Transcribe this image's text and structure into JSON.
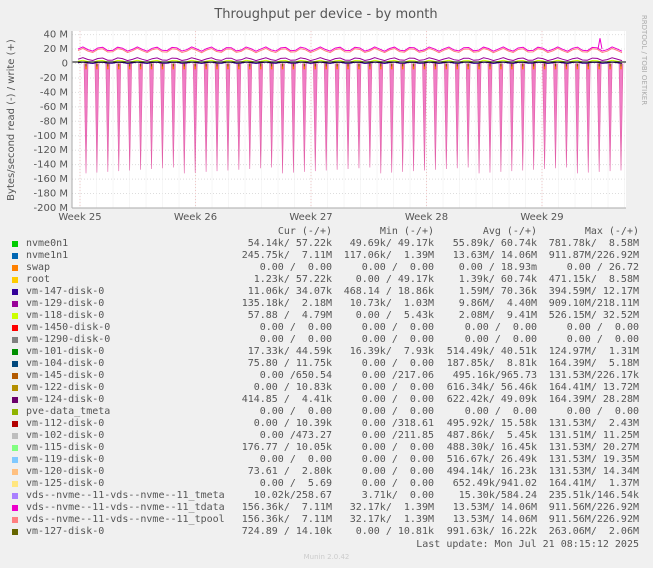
{
  "chart_data": {
    "type": "line",
    "title": "Throughput per device - by month",
    "ylabel": "Bytes/second read (-) / write (+)",
    "side_label": "RRDTOOL / TOBI OETIKER",
    "ylim": [
      -200000000,
      45000000
    ],
    "y_ticks": [
      "40 M",
      "20 M",
      "0",
      "-20 M",
      "-40 M",
      "-60 M",
      "-80 M",
      "-100 M",
      "-120 M",
      "-140 M",
      "-160 M",
      "-180 M",
      "-200 M"
    ],
    "y_tick_values": [
      40,
      20,
      0,
      -20,
      -40,
      -60,
      -80,
      -100,
      -120,
      -140,
      -160,
      -180,
      -200
    ],
    "x_ticks": [
      "Week 25",
      "Week 26",
      "Week 27",
      "Week 28",
      "Week 29"
    ],
    "grid": true,
    "columns": [
      "Cur (-/+)",
      "Min (-/+)",
      "Avg (-/+)",
      "Max (-/+)"
    ],
    "series": [
      {
        "name": "nvme0n1",
        "color": "#00cc00",
        "cur": "54.14k/ 57.22k",
        "min": "49.69k/ 49.17k",
        "avg": "55.89k/ 60.74k",
        "max": "781.78k/  8.58M"
      },
      {
        "name": "nvme1n1",
        "color": "#0066b3",
        "cur": "245.75k/  7.11M",
        "min": "117.06k/  1.39M",
        "avg": "13.63M/ 14.06M",
        "max": "911.87M/226.92M"
      },
      {
        "name": "swap",
        "color": "#ff8000",
        "cur": "0.00 /  0.00",
        "min": "0.00 /  0.00",
        "avg": "0.00 / 18.93m",
        "max": "0.00 / 26.72"
      },
      {
        "name": "root",
        "color": "#ffcc00",
        "cur": "1.23k/ 57.22k",
        "min": "0.00 / 49.17k",
        "avg": "1.39k/ 60.74k",
        "max": "471.15k/  8.58M"
      },
      {
        "name": "vm-147-disk-0",
        "color": "#330099",
        "cur": "11.06k/ 34.07k",
        "min": "468.14 / 18.86k",
        "avg": "1.59M/ 70.36k",
        "max": "394.59M/ 12.17M"
      },
      {
        "name": "vm-129-disk-0",
        "color": "#990099",
        "cur": "135.18k/  2.18M",
        "min": "10.73k/  1.03M",
        "avg": "9.86M/  4.40M",
        "max": "909.10M/218.11M"
      },
      {
        "name": "vm-118-disk-0",
        "color": "#ccff00",
        "cur": "57.88 /  4.79M",
        "min": "0.00 /  5.43k",
        "avg": "2.08M/  9.41M",
        "max": "526.15M/ 32.52M"
      },
      {
        "name": "vm-1450-disk-0",
        "color": "#ff0000",
        "cur": "0.00 /  0.00",
        "min": "0.00 /  0.00",
        "avg": "0.00 /  0.00",
        "max": "0.00 /  0.00"
      },
      {
        "name": "vm-1290-disk-0",
        "color": "#808080",
        "cur": "0.00 /  0.00",
        "min": "0.00 /  0.00",
        "avg": "0.00 /  0.00",
        "max": "0.00 /  0.00"
      },
      {
        "name": "vm-101-disk-0",
        "color": "#008f00",
        "cur": "17.33k/ 44.59k",
        "min": "16.39k/  7.93k",
        "avg": "514.49k/ 40.51k",
        "max": "124.97M/  1.31M"
      },
      {
        "name": "vm-104-disk-0",
        "color": "#00487d",
        "cur": "75.80 / 11.75k",
        "min": "0.00 /  0.00",
        "avg": "187.85k/  8.81k",
        "max": "164.39M/  5.18M"
      },
      {
        "name": "vm-145-disk-0",
        "color": "#b35a00",
        "cur": "0.00 /650.54",
        "min": "0.00 /217.06",
        "avg": "495.16k/965.73",
        "max": "131.53M/226.17k"
      },
      {
        "name": "vm-122-disk-0",
        "color": "#b38f00",
        "cur": "0.00 / 10.83k",
        "min": "0.00 /  0.00",
        "avg": "616.34k/ 56.46k",
        "max": "164.41M/ 13.72M"
      },
      {
        "name": "vm-124-disk-0",
        "color": "#6b006b",
        "cur": "414.85 /  4.41k",
        "min": "0.00 /  0.00",
        "avg": "622.42k/ 49.09k",
        "max": "164.39M/ 28.28M"
      },
      {
        "name": "pve-data_tmeta",
        "color": "#8fb300",
        "cur": "0.00 /  0.00",
        "min": "0.00 /  0.00",
        "avg": "0.00 /  0.00",
        "max": "0.00 /  0.00"
      },
      {
        "name": "vm-112-disk-0",
        "color": "#b30000",
        "cur": "0.00 / 10.39k",
        "min": "0.00 /318.61",
        "avg": "495.92k/ 15.58k",
        "max": "131.53M/  2.43M"
      },
      {
        "name": "vm-102-disk-0",
        "color": "#bebebe",
        "cur": "0.00 /473.27",
        "min": "0.00 /211.85",
        "avg": "487.86k/  5.45k",
        "max": "131.51M/ 11.25M"
      },
      {
        "name": "vm-115-disk-0",
        "color": "#80ff80",
        "cur": "176.77 / 10.05k",
        "min": "0.00 /  0.00",
        "avg": "488.30k/ 16.45k",
        "max": "131.53M/ 20.27M"
      },
      {
        "name": "vm-119-disk-0",
        "color": "#80c9ff",
        "cur": "0.00 /  0.00",
        "min": "0.00 /  0.00",
        "avg": "516.67k/ 26.49k",
        "max": "131.53M/ 19.35M"
      },
      {
        "name": "vm-120-disk-0",
        "color": "#ffc080",
        "cur": "73.61 /  2.80k",
        "min": "0.00 /  0.00",
        "avg": "494.14k/ 16.23k",
        "max": "131.53M/ 14.34M"
      },
      {
        "name": "vm-125-disk-0",
        "color": "#ffe680",
        "cur": "0.00 /  5.69",
        "min": "0.00 /  0.00",
        "avg": "652.49k/941.02",
        "max": "164.41M/  1.37M"
      },
      {
        "name": "vds--nvme--11-vds--nvme--11_tmeta",
        "color": "#aa80ff",
        "cur": "10.02k/258.67",
        "min": "3.71k/  0.00",
        "avg": "15.30k/584.24",
        "max": "235.51k/146.54k"
      },
      {
        "name": "vds--nvme--11-vds--nvme--11_tdata",
        "color": "#ee00cc",
        "cur": "156.36k/  7.11M",
        "min": "32.17k/  1.39M",
        "avg": "13.53M/ 14.06M",
        "max": "911.56M/226.92M"
      },
      {
        "name": "vds--nvme--11-vds--nvme--11_tpool",
        "color": "#ff8080",
        "cur": "156.36k/  7.11M",
        "min": "32.17k/  1.39M",
        "avg": "13.53M/ 14.06M",
        "max": "911.56M/226.92M"
      },
      {
        "name": "vm-127-disk-0",
        "color": "#666600",
        "cur": "724.89 / 14.10k",
        "min": "0.00 / 10.81k",
        "avg": "991.63k/ 16.22k",
        "max": "263.06M/  2.06M"
      }
    ],
    "spikes": {
      "count": 50,
      "read_depth": -148,
      "write_level": 20,
      "extra_write_peak": 35
    }
  },
  "last_update": "Last update: Mon Jul 21 08:15:12 2025",
  "footer": "Munin 2.0.42"
}
